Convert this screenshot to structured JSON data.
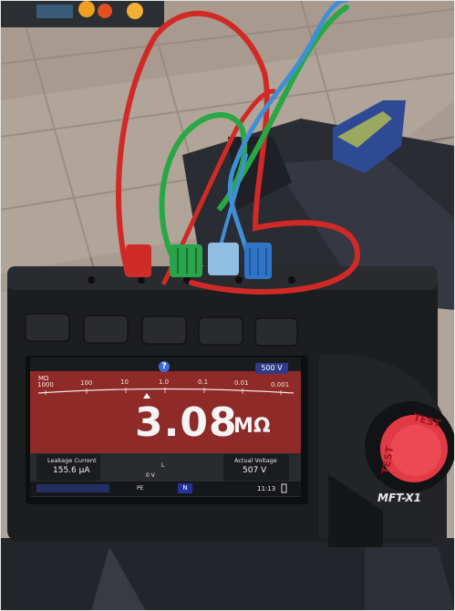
{
  "meter": {
    "model": "MFT-X1",
    "test_button_top": "TEST",
    "test_button_side": "TEST",
    "voltage_badge": "500 V",
    "help_icon": "?",
    "scale": {
      "unit": "MΩ",
      "labels": [
        "1000",
        "100",
        "10",
        "1.0",
        "0.1",
        "0.01",
        "0.001"
      ]
    },
    "reading": {
      "value": "3.08",
      "unit": "MΩ"
    },
    "leakage": {
      "label": "Leakage Current",
      "value": "155.6 µA"
    },
    "actual_voltage": {
      "label": "Actual Voltage",
      "value": "507 V"
    },
    "center": {
      "l": "L",
      "volts": "0 V",
      "pe": "PE",
      "n": "N"
    },
    "time": "11:13"
  },
  "colors": {
    "screen_red": "#8e2a28",
    "test_button": "#e23a44",
    "body": "#1c1d1f",
    "lead_red": "#d12a26",
    "lead_green": "#27a845",
    "lead_blue": "#3f8fd6"
  }
}
